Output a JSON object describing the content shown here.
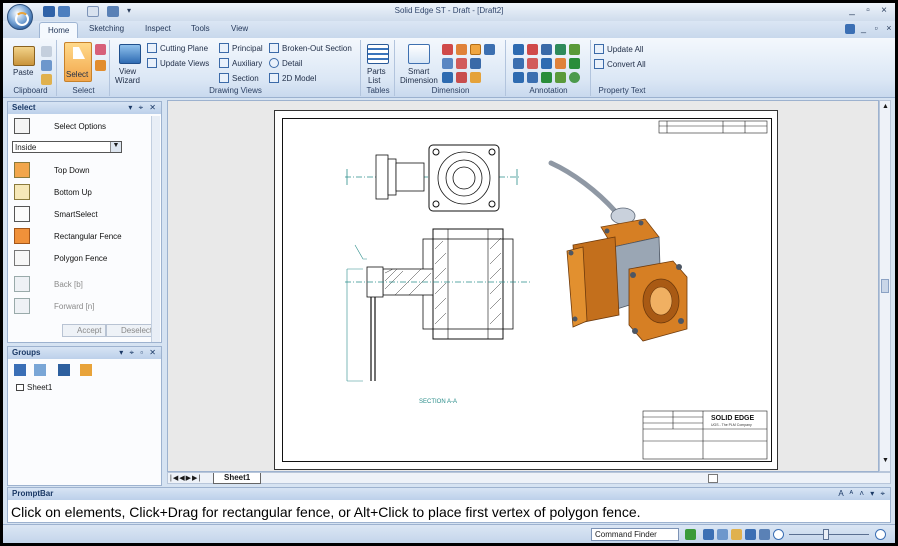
{
  "window": {
    "title": "Solid Edge ST - Draft - [Draft2]",
    "controls": [
      "_",
      "▫",
      "×"
    ]
  },
  "tabs": [
    "Home",
    "Sketching",
    "Inspect",
    "Tools",
    "View"
  ],
  "ribbon": {
    "clipboard": {
      "label": "Clipboard",
      "paste": "Paste"
    },
    "select": {
      "label": "Select",
      "select": "Select"
    },
    "drawing_views": {
      "label": "Drawing Views",
      "view_wizard": [
        "View",
        "Wizard"
      ],
      "cutting_plane": "Cutting Plane",
      "update_views": "Update Views",
      "principal": "Principal",
      "auxiliary": "Auxiliary",
      "section": "Section",
      "broken_out": "Broken-Out Section",
      "detail": "Detail",
      "model_2d": "2D Model"
    },
    "tables": {
      "label": "Tables",
      "parts_list": [
        "Parts",
        "List"
      ]
    },
    "dimension": {
      "label": "Dimension",
      "smart_dimension": [
        "Smart",
        "Dimension"
      ]
    },
    "annotation": {
      "label": "Annotation"
    },
    "property_text": {
      "label": "Property Text",
      "update_all": "Update All",
      "convert_all": "Convert All"
    }
  },
  "select_panel": {
    "title": "Select",
    "controls": "▾ ⌖ ✕",
    "select_options": "Select Options",
    "dropdown_value": "Inside",
    "items": [
      "Top Down",
      "Bottom Up",
      "SmartSelect",
      "Rectangular Fence",
      "Polygon Fence"
    ],
    "back": "Back [b]",
    "forward": "Forward [n]",
    "accept": "Accept",
    "deselect": "Deselect"
  },
  "groups_panel": {
    "title": "Groups",
    "controls": "▾ ⌖ ▫ ✕",
    "tree_item": "Sheet1"
  },
  "drawing": {
    "section_label": "SECTION A-A",
    "title_block_brand": "SOLID EDGE",
    "title_block_sub": "UGS - The PLM Company"
  },
  "sheet_tab": "Sheet1",
  "promptbar": {
    "title": "PromptBar",
    "controls": "A ᴬ ˄ ▾ ⌖",
    "text": "Click on elements, Click+Drag for rectangular fence, or Alt+Click to place first vertex of polygon fence."
  },
  "statusbar": {
    "command_finder": "Command Finder"
  },
  "colors": {
    "accent": "#f2a64b",
    "ribbon_blue": "#dbe7f5",
    "valve_orange": "#d67f24",
    "valve_grey": "#9aa6b4",
    "teal": "#2a8d8a"
  }
}
